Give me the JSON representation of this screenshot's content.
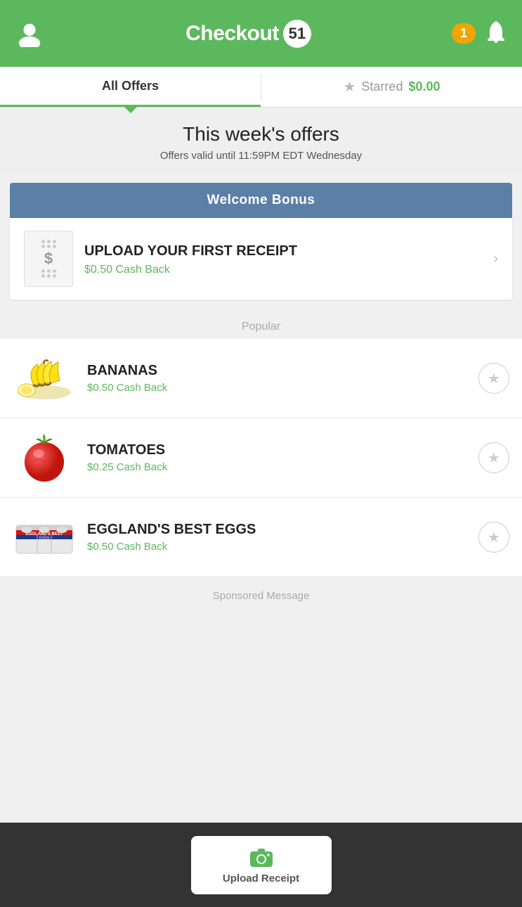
{
  "header": {
    "logo_text": "Checkout",
    "logo_number": "51",
    "notification_count": "1",
    "profile_icon": "user-icon",
    "bell_icon": "bell-icon"
  },
  "tabs": {
    "all_offers_label": "All Offers",
    "starred_label": "Starred",
    "starred_amount": "$0.00"
  },
  "week_section": {
    "title": "This week's offers",
    "subtitle": "Offers valid until 11:59PM EDT Wednesday"
  },
  "welcome_bonus": {
    "banner_label": "Welcome Bonus",
    "receipt_title": "UPLOAD YOUR FIRST RECEIPT",
    "receipt_cashback": "$0.50 Cash Back"
  },
  "popular_section": {
    "label": "Popular",
    "items": [
      {
        "name": "BANANAS",
        "cashback": "$0.50 Cash Back"
      },
      {
        "name": "TOMATOES",
        "cashback": "$0.25 Cash Back"
      },
      {
        "name": "EGGLAND'S BEST EGGS",
        "cashback": "$0.50 Cash Back"
      }
    ]
  },
  "sponsored": {
    "label": "Sponsored Message"
  },
  "bottom_bar": {
    "upload_label": "Upload Receipt"
  }
}
